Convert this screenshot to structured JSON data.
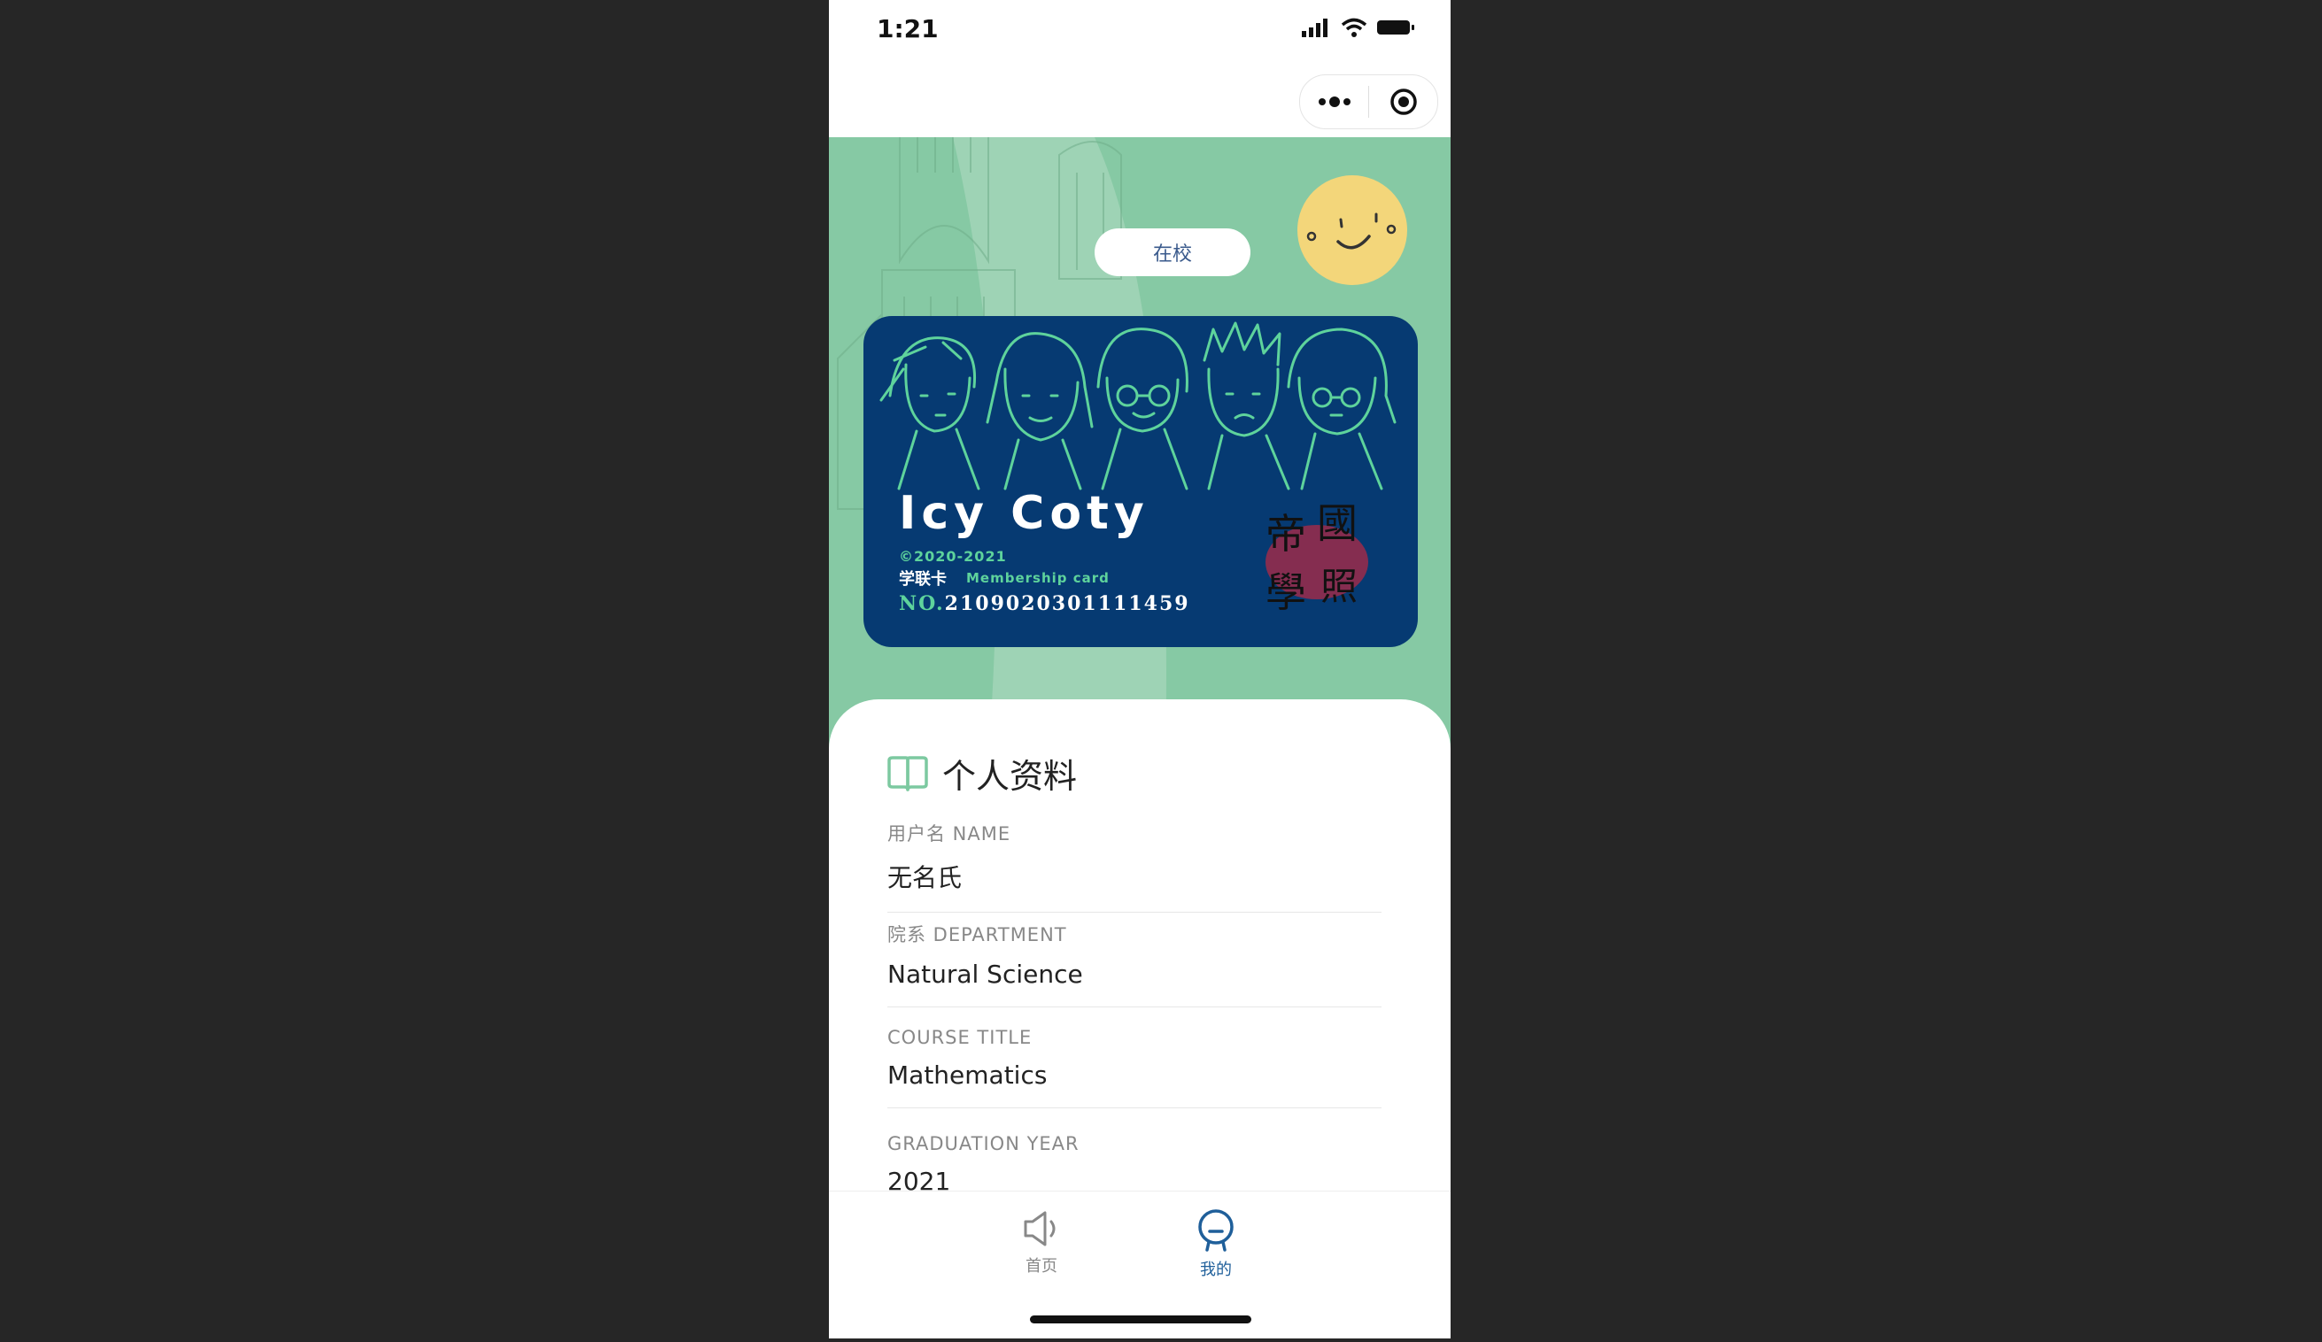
{
  "status_bar": {
    "time": "1:21"
  },
  "capsule": {
    "more_icon": "more-dots-icon",
    "close_icon": "target-icon"
  },
  "hero": {
    "status": "在校",
    "avatar_icon": "smiley-face-icon",
    "card": {
      "name": "Icy Coty",
      "year": "©2020-2021",
      "type_cn": "学联卡",
      "type_en": "Membership card",
      "no_prefix": "NO.",
      "number": "2109020301111459",
      "seal_text": [
        "帝",
        "國",
        "學",
        "照"
      ]
    }
  },
  "profile": {
    "title": "个人资料",
    "fields": [
      {
        "label": "用户名 NAME",
        "value": "无名氏"
      },
      {
        "label": "院系 DEPARTMENT",
        "value": "Natural Science"
      },
      {
        "label": "COURSE TITLE",
        "value": "Mathematics"
      },
      {
        "label": "GRADUATION YEAR",
        "value": "2021"
      }
    ]
  },
  "tabbar": {
    "tabs": [
      {
        "label": "首页",
        "icon": "megaphone-icon",
        "active": false
      },
      {
        "label": "我的",
        "icon": "user-icon",
        "active": true
      }
    ]
  },
  "colors": {
    "accent": "#1f5f9a",
    "hero_green": "#86c9a4",
    "card_blue": "#063a72",
    "card_green": "#5ed39c"
  }
}
